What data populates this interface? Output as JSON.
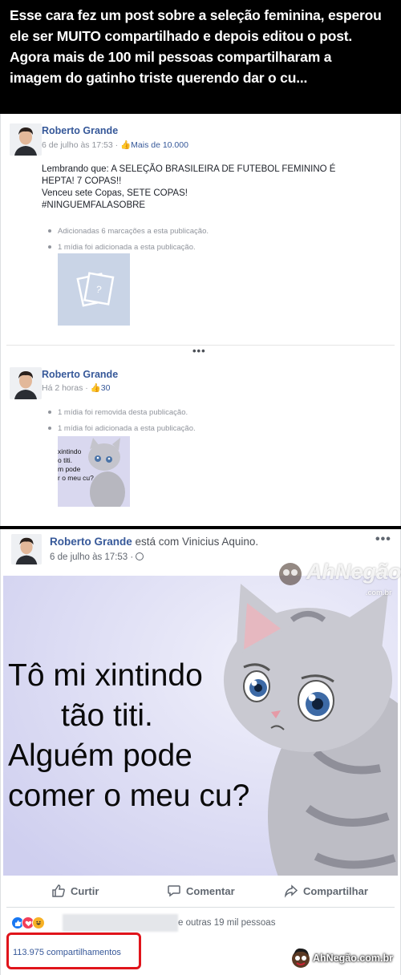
{
  "banner": {
    "line1": "Esse cara fez um post sobre a seleção feminina, esperou",
    "line2": "ele ser MUITO compartilhado e depois editou o post.",
    "line3": "Agora mais de 100 mil pessoas compartilharam a",
    "line4": "imagem do gatinho triste querendo dar o cu..."
  },
  "post1": {
    "author": "Roberto Grande",
    "date": "6 de julho às 17:53 · ",
    "likes": "Mais de 10.000",
    "text_line1": "Lembrando que: A SELEÇÃO BRASILEIRA DE FUTEBOL FEMININO É",
    "text_line2": "HEPTA! 7 COPAS!!",
    "text_line3": "Venceu sete Copas, SETE COPAS!",
    "text_line4": "#NINGUEMFALASOBRE",
    "activity1": "Adicionadas 6 marcações a esta publicação.",
    "activity2": "1 mídia foi adicionada a esta publicação."
  },
  "post2": {
    "author": "Roberto Grande",
    "date": "Há 2 horas · ",
    "likes": "30",
    "activity1": "1 mídia foi removida desta publicação.",
    "activity2": "1 mídia foi adicionada a esta publicação.",
    "thumb_text_line1": "xintindo",
    "thumb_text_line2": "o titi.",
    "thumb_text_line3": "m pode",
    "thumb_text_line4": "r o meu cu?"
  },
  "ellipsis": "•••",
  "post3": {
    "author": "Roberto Grande",
    "with_text": " está com ",
    "tagged": "Vinicius Aquino.",
    "date": "6 de julho às 17:53 · ",
    "more": "•••",
    "meme_line1": "Tô mi xintindo",
    "meme_line2": "tão titi.",
    "meme_line3": "Alguém pode",
    "meme_line4": "comer o meu cu?",
    "watermark": "AhNegão!",
    "watermark_sub": ".com.br",
    "action_like": "Curtir",
    "action_comment": "Comentar",
    "action_share": "Compartilhar",
    "others": "e outras 19 mil pessoas",
    "shares": "113.975 compartilhamentos",
    "footer_watermark": "AhNegão.com.br"
  },
  "colors": {
    "fb_blue": "#365899",
    "highlight_red": "#e0141b",
    "meme_bg": "#dcdcf3"
  }
}
